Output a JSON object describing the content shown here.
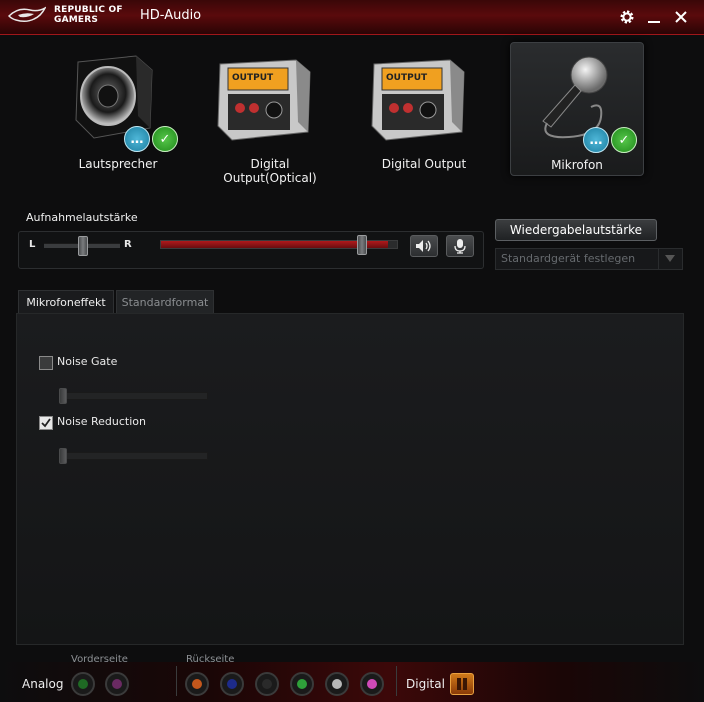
{
  "window": {
    "brand_line1": "REPUBLIC OF",
    "brand_line2": "GAMERS",
    "title": "HD-Audio",
    "settings_icon": "gear-icon",
    "minimize_icon": "minimize-icon",
    "close_icon": "close-icon"
  },
  "devices": [
    {
      "label": "Lautsprecher",
      "icon": "speaker-icon",
      "selected": false,
      "has_status": true
    },
    {
      "label": "Digital Output(Optical)",
      "icon": "digital-output-icon",
      "selected": false,
      "has_status": false
    },
    {
      "label": "Digital Output",
      "icon": "digital-output-icon",
      "selected": false,
      "has_status": false
    },
    {
      "label": "Mikrofon",
      "icon": "microphone-icon",
      "selected": true,
      "has_status": true
    }
  ],
  "recording": {
    "title": "Aufnahmelautstärke",
    "left_label": "L",
    "right_label": "R",
    "balance": 0.5,
    "volume_level": 0.96,
    "speaker_button_icon": "speaker-volume-icon",
    "mic_button_icon": "microphone-mute-icon"
  },
  "right_controls": {
    "playback_button": "Wiedergabelautstärke",
    "default_device_placeholder": "Standardgerät festlegen"
  },
  "tabs": [
    {
      "label": "Mikrofoneffekt",
      "active": true
    },
    {
      "label": "Standardformat",
      "active": false
    }
  ],
  "effects": [
    {
      "label": "Noise Gate",
      "checked": false
    },
    {
      "label": "Noise Reduction",
      "checked": true
    }
  ],
  "jacks": {
    "analog_label": "Analog",
    "front_label": "Vorderseite",
    "rear_label": "Rückseite",
    "digital_label": "Digital",
    "front_colors": [
      "#1f6a24",
      "#6a2a62"
    ],
    "rear_colors": [
      "#c4571c",
      "#1d2b8a",
      "#2a2a2a",
      "#2fa03a",
      "#b8b8b8",
      "#d04ab8"
    ]
  },
  "colors": {
    "accent_red": "#a0161a",
    "volume_fill": "#8a1416",
    "check_green": "#2e9e24",
    "chat_blue": "#2a93b8"
  }
}
